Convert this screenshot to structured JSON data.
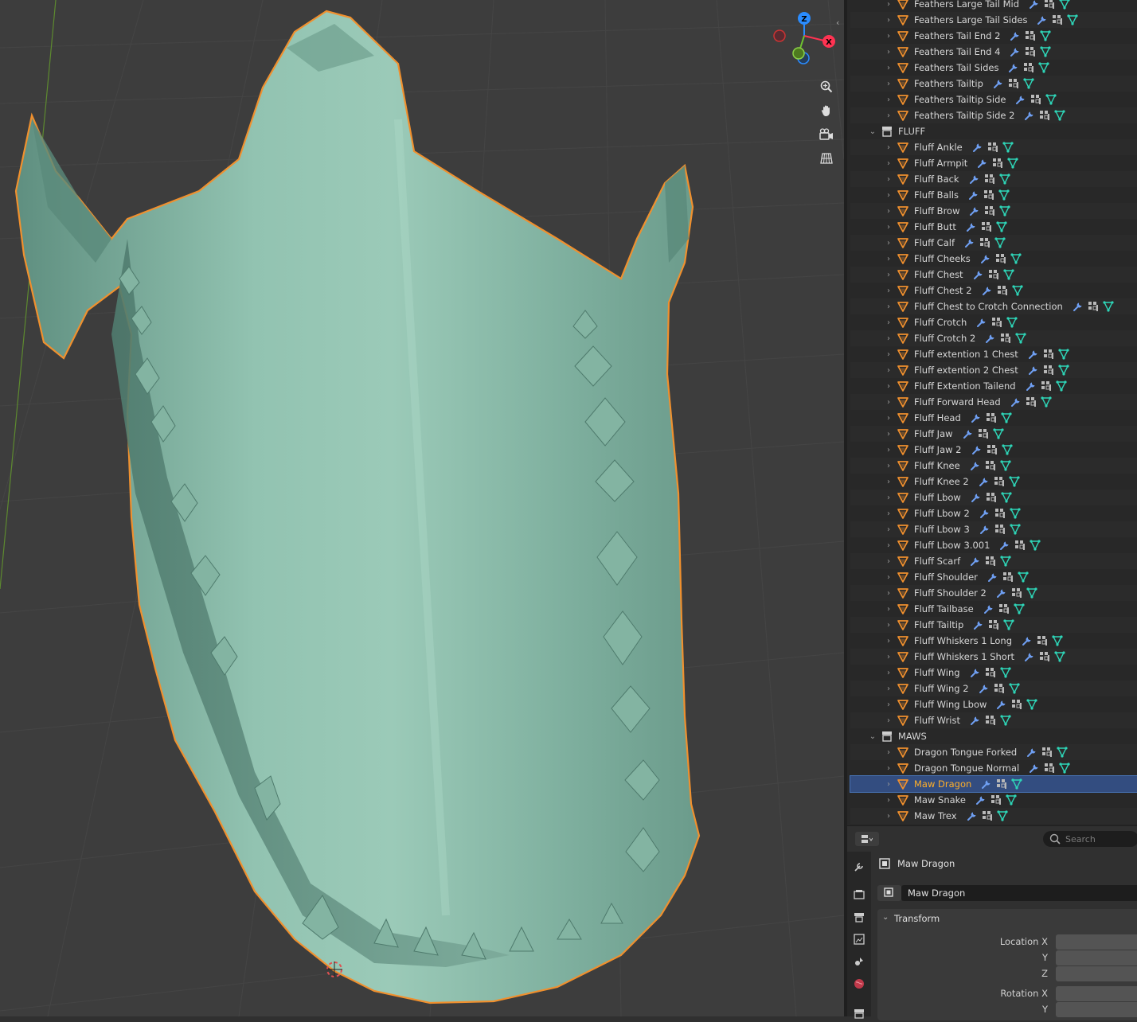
{
  "viewport": {
    "gizmo": {
      "z_label": "Z",
      "x_label": "X"
    },
    "nav_buttons": [
      "zoom-icon",
      "hand-icon",
      "camera-icon",
      "grid-icon"
    ]
  },
  "outliner": {
    "rows": [
      {
        "type": "obj",
        "label": "Feathers Large Tail Mid",
        "indent": 1
      },
      {
        "type": "obj",
        "label": "Feathers Large Tail Sides",
        "indent": 1
      },
      {
        "type": "obj",
        "label": "Feathers Tail End 2",
        "indent": 1
      },
      {
        "type": "obj",
        "label": "Feathers Tail End 4",
        "indent": 1
      },
      {
        "type": "obj",
        "label": "Feathers Tail Sides",
        "indent": 1
      },
      {
        "type": "obj",
        "label": "Feathers Tailtip",
        "indent": 1
      },
      {
        "type": "obj",
        "label": "Feathers Tailtip Side",
        "indent": 1
      },
      {
        "type": "obj",
        "label": "Feathers Tailtip Side 2",
        "indent": 1
      },
      {
        "type": "coll",
        "label": "FLUFF"
      },
      {
        "type": "obj",
        "label": "Fluff Ankle",
        "indent": 1
      },
      {
        "type": "obj",
        "label": "Fluff Armpit",
        "indent": 1
      },
      {
        "type": "obj",
        "label": "Fluff Back",
        "indent": 1
      },
      {
        "type": "obj",
        "label": "Fluff Balls",
        "indent": 1
      },
      {
        "type": "obj",
        "label": "Fluff Brow",
        "indent": 1
      },
      {
        "type": "obj",
        "label": "Fluff Butt",
        "indent": 1
      },
      {
        "type": "obj",
        "label": "Fluff Calf",
        "indent": 1
      },
      {
        "type": "obj",
        "label": "Fluff Cheeks",
        "indent": 1
      },
      {
        "type": "obj",
        "label": "Fluff Chest",
        "indent": 1
      },
      {
        "type": "obj",
        "label": "Fluff Chest 2",
        "indent": 1
      },
      {
        "type": "obj",
        "label": "Fluff Chest to Crotch Connection",
        "indent": 1
      },
      {
        "type": "obj",
        "label": "Fluff Crotch",
        "indent": 1
      },
      {
        "type": "obj",
        "label": "Fluff Crotch 2",
        "indent": 1
      },
      {
        "type": "obj",
        "label": "Fluff extention 1 Chest",
        "indent": 1
      },
      {
        "type": "obj",
        "label": "Fluff extention 2 Chest",
        "indent": 1
      },
      {
        "type": "obj",
        "label": "Fluff Extention Tailend",
        "indent": 1
      },
      {
        "type": "obj",
        "label": "Fluff Forward Head",
        "indent": 1
      },
      {
        "type": "obj",
        "label": "Fluff Head",
        "indent": 1
      },
      {
        "type": "obj",
        "label": "Fluff Jaw",
        "indent": 1
      },
      {
        "type": "obj",
        "label": "Fluff Jaw 2",
        "indent": 1
      },
      {
        "type": "obj",
        "label": "Fluff Knee",
        "indent": 1
      },
      {
        "type": "obj",
        "label": "Fluff Knee 2",
        "indent": 1
      },
      {
        "type": "obj",
        "label": "Fluff Lbow",
        "indent": 1
      },
      {
        "type": "obj",
        "label": "Fluff Lbow 2",
        "indent": 1
      },
      {
        "type": "obj",
        "label": "Fluff Lbow 3",
        "indent": 1
      },
      {
        "type": "obj",
        "label": "Fluff Lbow 3.001",
        "indent": 1
      },
      {
        "type": "obj",
        "label": "Fluff Scarf",
        "indent": 1
      },
      {
        "type": "obj",
        "label": "Fluff Shoulder",
        "indent": 1
      },
      {
        "type": "obj",
        "label": "Fluff Shoulder 2",
        "indent": 1
      },
      {
        "type": "obj",
        "label": "Fluff Tailbase",
        "indent": 1
      },
      {
        "type": "obj",
        "label": "Fluff Tailtip",
        "indent": 1
      },
      {
        "type": "obj",
        "label": "Fluff Whiskers 1 Long",
        "indent": 1
      },
      {
        "type": "obj",
        "label": "Fluff Whiskers 1 Short",
        "indent": 1
      },
      {
        "type": "obj",
        "label": "Fluff Wing",
        "indent": 1
      },
      {
        "type": "obj",
        "label": "Fluff Wing 2",
        "indent": 1
      },
      {
        "type": "obj",
        "label": "Fluff Wing Lbow",
        "indent": 1
      },
      {
        "type": "obj",
        "label": "Fluff Wrist",
        "indent": 1
      },
      {
        "type": "coll",
        "label": "MAWS"
      },
      {
        "type": "obj",
        "label": "Dragon Tongue Forked",
        "indent": 1
      },
      {
        "type": "obj",
        "label": "Dragon Tongue Normal",
        "indent": 1
      },
      {
        "type": "obj",
        "label": "Maw Dragon",
        "indent": 1,
        "selected": true
      },
      {
        "type": "obj",
        "label": "Maw Snake",
        "indent": 1
      },
      {
        "type": "obj",
        "label": "Maw Trex",
        "indent": 1
      }
    ]
  },
  "properties": {
    "search_placeholder": "Search",
    "object_name": "Maw Dragon",
    "datablock_name": "Maw Dragon",
    "panel_title": "Transform",
    "location_x_label": "Location X",
    "location_y_label": "Y",
    "location_z_label": "Z",
    "rotation_x_label": "Rotation X",
    "rotation_y_label": "Y"
  },
  "colors": {
    "selection_outline": "#f0902e",
    "mesh": "#8fbfad",
    "selected_row": "#334d80",
    "highlight_text": "#ffaf29"
  }
}
